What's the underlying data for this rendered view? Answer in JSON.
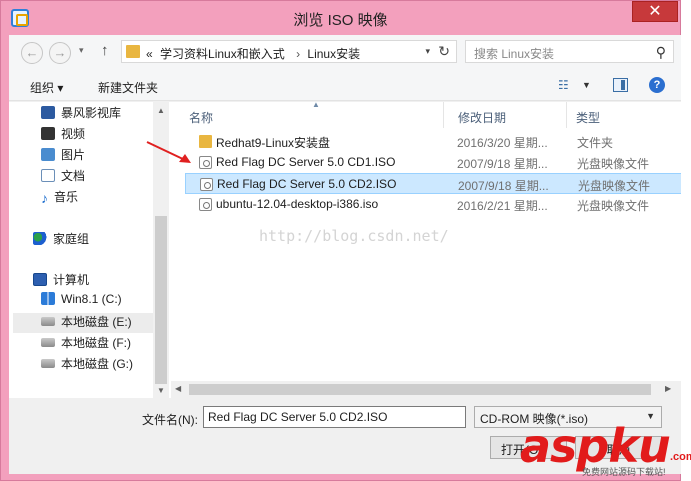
{
  "window": {
    "title": "浏览 ISO 映像",
    "close_label": "✕"
  },
  "nav": {
    "back_label": "←",
    "forward_label": "→",
    "up_label": "↑",
    "breadcrumb": [
      "«",
      "学习资料Linux和嵌入式",
      "Linux安装"
    ],
    "separator": "›",
    "search_placeholder": "搜索 Linux安装"
  },
  "toolbar": {
    "organize_label": "组织 ▾",
    "new_folder_label": "新建文件夹"
  },
  "sidebar": {
    "items": [
      {
        "label": "暴风影视库",
        "icon": "video-library-icon"
      },
      {
        "label": "视频",
        "icon": "video-icon"
      },
      {
        "label": "图片",
        "icon": "pictures-icon"
      },
      {
        "label": "文档",
        "icon": "documents-icon"
      },
      {
        "label": "音乐",
        "icon": "music-icon"
      },
      {
        "label": "家庭组",
        "icon": "homegroup-icon"
      },
      {
        "label": "计算机",
        "icon": "computer-icon"
      },
      {
        "label": "Win8.1 (C:)",
        "icon": "windows-drive-icon"
      },
      {
        "label": "本地磁盘 (E:)",
        "icon": "drive-icon"
      },
      {
        "label": "本地磁盘 (F:)",
        "icon": "drive-icon"
      },
      {
        "label": "本地磁盘 (G:)",
        "icon": "drive-icon"
      }
    ]
  },
  "columns": {
    "name": "名称",
    "date": "修改日期",
    "type": "类型"
  },
  "files": [
    {
      "name": "Redhat9-Linux安装盘",
      "date": "2016/3/20 星期...",
      "type": "文件夹",
      "icon": "folder-icon"
    },
    {
      "name": "Red Flag DC Server 5.0 CD1.ISO",
      "date": "2007/9/18 星期...",
      "type": "光盘映像文件",
      "icon": "disc-image-icon"
    },
    {
      "name": "Red Flag DC Server 5.0 CD2.ISO",
      "date": "2007/9/18 星期...",
      "type": "光盘映像文件",
      "icon": "disc-image-icon"
    },
    {
      "name": "ubuntu-12.04-desktop-i386.iso",
      "date": "2016/2/21 星期...",
      "type": "光盘映像文件",
      "icon": "disc-image-icon"
    }
  ],
  "watermark": "http://blog.csdn.net/",
  "footer": {
    "filename_label": "文件名(N):",
    "filename_value": "Red Flag DC Server 5.0 CD2.ISO",
    "filetype_value": "CD-ROM 映像(*.iso)",
    "open_label": "打开(O)",
    "cancel_label": "取消"
  },
  "logo": {
    "text": "aspku",
    "suffix": ".com",
    "tagline": "免费网站源码下载站!"
  },
  "colors": {
    "accent": "#cce8ff",
    "close": "#c7393b",
    "logo_red": "#e21b1b"
  }
}
